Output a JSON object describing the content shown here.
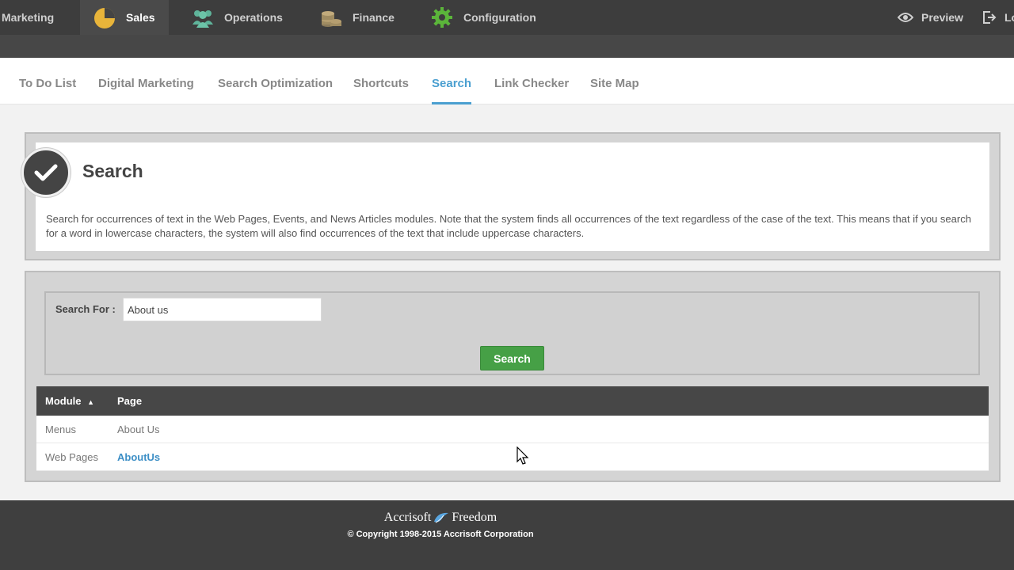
{
  "topnav": {
    "items": [
      {
        "label": "Marketing",
        "icon": "marketing-icon",
        "active": false
      },
      {
        "label": "Sales",
        "icon": "pie-chart-icon",
        "active": true
      },
      {
        "label": "Operations",
        "icon": "people-icon",
        "active": false
      },
      {
        "label": "Finance",
        "icon": "coins-icon",
        "active": false
      },
      {
        "label": "Configuration",
        "icon": "gear-icon",
        "active": false
      }
    ],
    "preview_label": "Preview",
    "logout_label": "Log"
  },
  "subnav": {
    "tabs": [
      {
        "label": "To Do List",
        "active": false
      },
      {
        "label": "Digital Marketing",
        "active": false
      },
      {
        "label": "Search Optimization",
        "active": false
      },
      {
        "label": "Shortcuts",
        "active": false
      },
      {
        "label": "Search",
        "active": true
      },
      {
        "label": "Link Checker",
        "active": false
      },
      {
        "label": "Site Map",
        "active": false
      }
    ]
  },
  "page": {
    "title": "Search",
    "description": "Search for occurrences of text in the Web Pages, Events, and News Articles modules. Note that the system finds all occurrences of the text regardless of the case of the text. This means that if you search for a word in lowercase characters, the system will also find occurrences of the text that include uppercase characters."
  },
  "search": {
    "label": "Search For :",
    "value": "About us",
    "button_label": "Search"
  },
  "results": {
    "columns": [
      "Module",
      "Page"
    ],
    "sort_indicator": "▲",
    "rows": [
      {
        "module": "Menus",
        "page": "About Us",
        "page_is_link": false
      },
      {
        "module": "Web Pages",
        "page": "AboutUs",
        "page_is_link": true
      }
    ]
  },
  "footer": {
    "brand_left": "Accrisoft",
    "brand_right": "Freedom",
    "copyright": "© Copyright 1998-2015 Accrisoft Corporation"
  },
  "colors": {
    "accent": "#4a9fd0",
    "button_green": "#46a046",
    "topbar": "#3d3d3d",
    "link": "#3d8fc6"
  }
}
